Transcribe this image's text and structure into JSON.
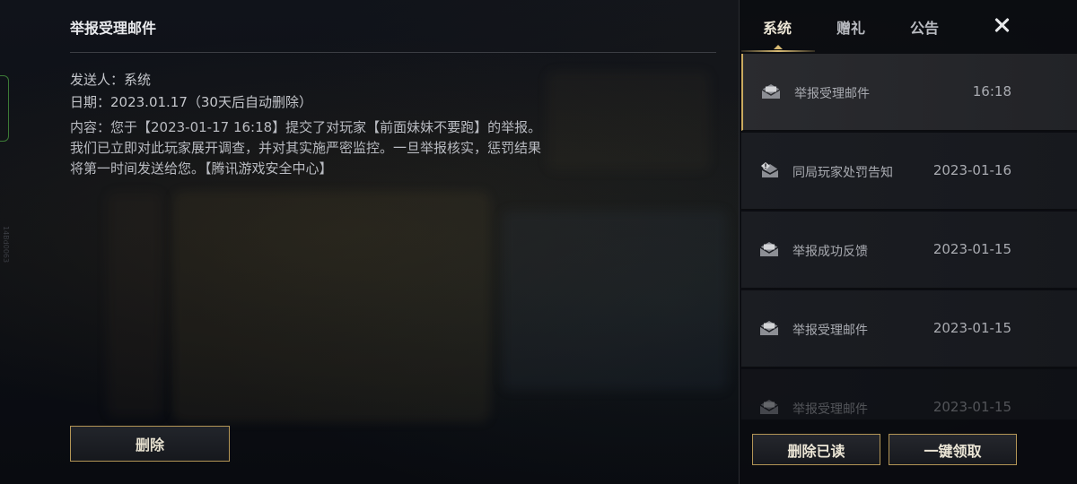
{
  "detail": {
    "title": "举报受理邮件",
    "sender_line": "发送人：系统",
    "date_line": "日期：2023.01.17（30天后自动删除）",
    "content": "内容：您于【2023-01-17 16:18】提交了对玩家【前面妹妹不要跑】的举报。我们已立即对此玩家展开调查，并对其实施严密监控。一旦举报核实，惩罚结果将第一时间发送给您。【腾讯游戏安全中心】",
    "delete_label": "删除"
  },
  "tabs": [
    {
      "label": "系统",
      "active": true
    },
    {
      "label": "赠礼",
      "active": false
    },
    {
      "label": "公告",
      "active": false
    }
  ],
  "mails": [
    {
      "subject": "举报受理邮件",
      "date": "16:18",
      "icon": "mail-open-icon",
      "selected": true
    },
    {
      "subject": "同局玩家处罚告知",
      "date": "2023-01-16",
      "icon": "mail-alert-icon",
      "selected": false
    },
    {
      "subject": "举报成功反馈",
      "date": "2023-01-15",
      "icon": "mail-open-icon",
      "selected": false
    },
    {
      "subject": "举报受理邮件",
      "date": "2023-01-15",
      "icon": "mail-open-icon",
      "selected": false
    },
    {
      "subject": "举报受理邮件",
      "date": "2023-01-15",
      "icon": "mail-open-icon",
      "selected": false
    }
  ],
  "actions": {
    "delete_read_label": "删除已读",
    "claim_all_label": "一键领取"
  },
  "side_code": "14Bd0063",
  "colors": {
    "accent_gold": "#c9a95e",
    "panel_bg": "#17191e",
    "text_primary": "#e8e9ec"
  }
}
